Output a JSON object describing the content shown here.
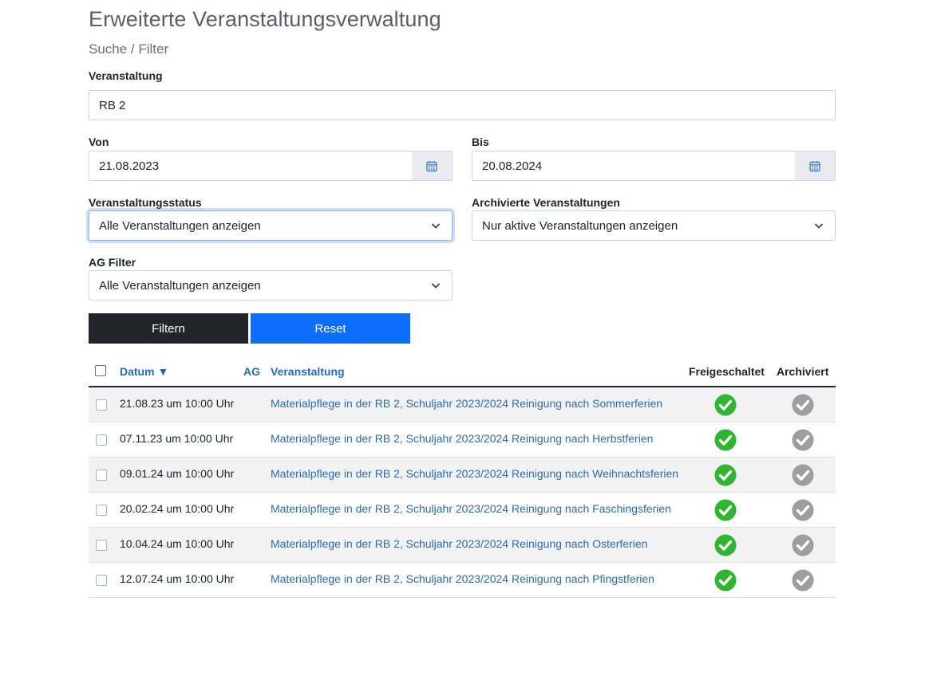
{
  "page": {
    "title": "Erweiterte Veranstaltungsverwaltung",
    "subtitle": "Suche / Filter"
  },
  "filter": {
    "event_label": "Veranstaltung",
    "event_value": "RB 2",
    "from_label": "Von",
    "from_value": "21.08.2023",
    "to_label": "Bis",
    "to_value": "20.08.2024",
    "status_label": "Veranstaltungsstatus",
    "status_value": "Alle Veranstaltungen anzeigen",
    "archived_label": "Archivierte Veranstaltungen",
    "archived_value": "Nur aktive Veranstaltungen anzeigen",
    "ag_label": "AG Filter",
    "ag_value": "Alle Veranstaltungen anzeigen",
    "filter_button": "Filtern",
    "reset_button": "Reset"
  },
  "table": {
    "headers": {
      "date": "Datum ▼",
      "ag": "AG",
      "event": "Veranstaltung",
      "released": "Freigeschaltet",
      "archived": "Archiviert"
    },
    "rows": [
      {
        "date": "21.08.23 um 10:00 Uhr",
        "event": "Materialpflege in der RB 2, Schuljahr 2023/2024 Reinigung nach Sommerferien",
        "released": true,
        "archived": false
      },
      {
        "date": "07.11.23 um 10:00 Uhr",
        "event": "Materialpflege in der RB 2, Schuljahr 2023/2024 Reinigung nach Herbstferien",
        "released": true,
        "archived": false
      },
      {
        "date": "09.01.24 um 10:00 Uhr",
        "event": "Materialpflege in der RB 2, Schuljahr 2023/2024 Reinigung nach Weihnachtsferien",
        "released": true,
        "archived": false
      },
      {
        "date": "20.02.24 um 10:00 Uhr",
        "event": "Materialpflege in der RB 2, Schuljahr 2023/2024 Reinigung nach Faschingsferien",
        "released": true,
        "archived": false
      },
      {
        "date": "10.04.24 um 10:00 Uhr",
        "event": "Materialpflege in der RB 2, Schuljahr 2023/2024 Reinigung nach Osterferien",
        "released": true,
        "archived": false
      },
      {
        "date": "12.07.24 um 10:00 Uhr",
        "event": "Materialpflege in der RB 2, Schuljahr 2023/2024 Reinigung nach Pfingstferien",
        "released": true,
        "archived": false
      }
    ]
  },
  "colors": {
    "released_icon": "#2fb52f",
    "archived_icon": "#9e9e9e",
    "link": "#2a6cb8",
    "primary": "#0d6efd",
    "dark": "#212529"
  },
  "icons": {
    "date_picker": "calendar-icon",
    "select": "chevron-down-icon",
    "status": "check-circle-icon"
  }
}
